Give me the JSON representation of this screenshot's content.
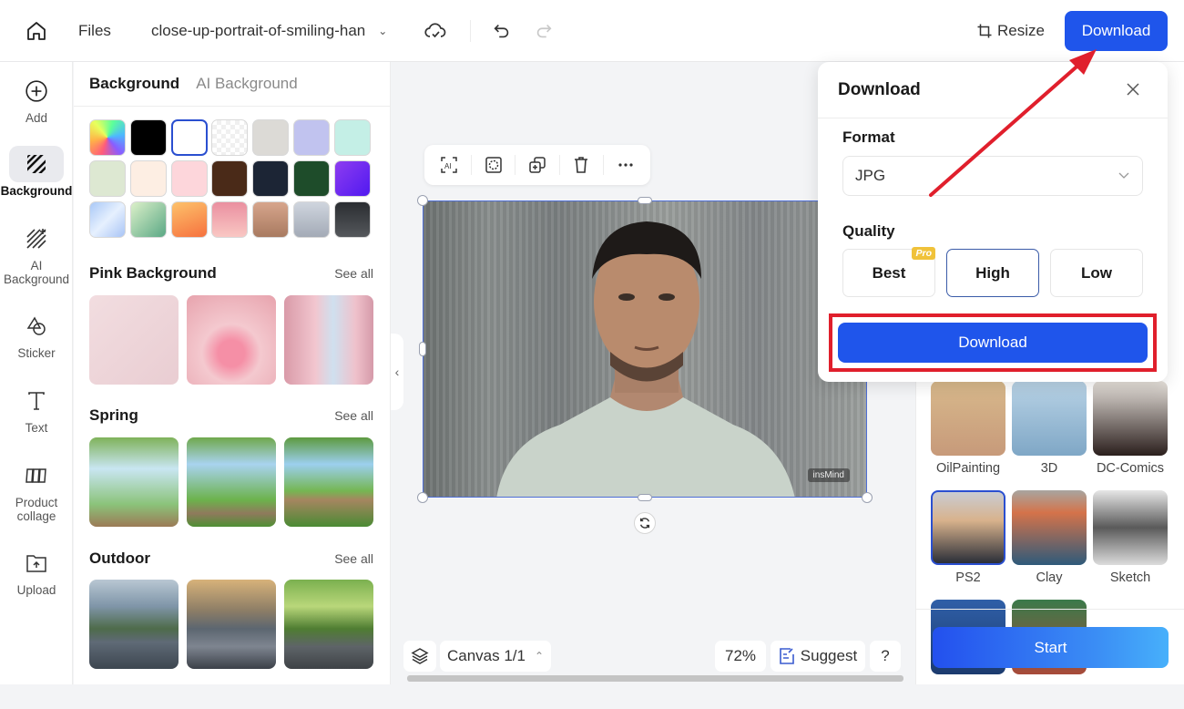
{
  "topbar": {
    "files_label": "Files",
    "filename": "close-up-portrait-of-smiling-han",
    "resize_label": "Resize",
    "download_label": "Download",
    "icons": [
      "home-icon",
      "chevron-down-icon",
      "cloud-sync-icon",
      "undo-icon",
      "redo-icon",
      "crop-icon"
    ]
  },
  "leftrail": {
    "items": [
      {
        "label": "Add",
        "icon": "plus-circle-icon",
        "active": false
      },
      {
        "label": "Background",
        "icon": "background-icon",
        "active": true
      },
      {
        "label": "AI Background",
        "icon": "ai-background-icon",
        "active": false
      },
      {
        "label": "Sticker",
        "icon": "sticker-icon",
        "active": false
      },
      {
        "label": "Text",
        "icon": "text-icon",
        "active": false
      },
      {
        "label": "Product collage",
        "icon": "collage-icon",
        "active": false
      },
      {
        "label": "Upload",
        "icon": "upload-icon",
        "active": false
      }
    ]
  },
  "bgpanel": {
    "tabs": [
      {
        "label": "Background",
        "active": true
      },
      {
        "label": "AI Background",
        "active": false
      }
    ],
    "swatches": [
      {
        "name": "rainbow",
        "fill": "conic-gradient(from 200deg, #ff5c7a, #ffb347, #e8ff5c, #5cff9a, #4db8ff, #8a5cff, #ff5c7a)"
      },
      {
        "name": "black",
        "fill": "#000000"
      },
      {
        "name": "white",
        "fill": "#ffffff",
        "selected": true
      },
      {
        "name": "transparent",
        "fill": "repeating-conic-gradient(#f0f0f0 0 25%, #ffffff 0 50%) 0 0/10px 10px"
      },
      {
        "name": "stone",
        "fill": "#dcdad6"
      },
      {
        "name": "lavender",
        "fill": "#c1c3ef"
      },
      {
        "name": "mint",
        "fill": "#c4efe6"
      },
      {
        "name": "sage",
        "fill": "#dde8d2"
      },
      {
        "name": "cream",
        "fill": "#fdeee3"
      },
      {
        "name": "blush",
        "fill": "#fdd6db"
      },
      {
        "name": "brown",
        "fill": "#4a2a18"
      },
      {
        "name": "navy",
        "fill": "#1c2535"
      },
      {
        "name": "forest",
        "fill": "#1e4c2a"
      },
      {
        "name": "violet",
        "fill": "linear-gradient(135deg, #8e3df0, #5019f0)"
      },
      {
        "name": "sky-gradient",
        "fill": "linear-gradient(135deg, #a9c8f7, #e6f0fe, #a8c4f6)"
      },
      {
        "name": "green-gradient",
        "fill": "linear-gradient(135deg, #dcf0c9, #5aa885)"
      },
      {
        "name": "orange-gradient",
        "fill": "linear-gradient(160deg, #fdc26b, #f6713e)"
      },
      {
        "name": "pink-gradient",
        "fill": "linear-gradient(180deg, #ea8fa0, #f9c7c3)"
      },
      {
        "name": "tan-gradient",
        "fill": "linear-gradient(180deg, #d7a58c, #a87a60)"
      },
      {
        "name": "silver-gradient",
        "fill": "linear-gradient(180deg, #cfd5de, #a3aab6)"
      },
      {
        "name": "charcoal-gradient",
        "fill": "linear-gradient(180deg, #2a2d31, #55585c)"
      }
    ],
    "sections": [
      {
        "title": "Pink Background",
        "see_all": "See all",
        "thumbs": [
          "linear-gradient(135deg, #f2dde0, #e9cdd2)",
          "radial-gradient(circle at 50% 65%, #f58fa6 0 18%, #f4c9cf 40%, #e7a3ad 100%)",
          "linear-gradient(90deg, #d99aa8 0%, #f2c6cf 35%, #cfe0ef 55%, #efc1cb 80%, #d59aa9 100%)"
        ]
      },
      {
        "title": "Spring",
        "see_all": "See all",
        "thumbs": [
          "linear-gradient(180deg, #7fb25a 0%, #c9e6f2 35%, #8bc37a 75%, #9b7a56 100%)",
          "linear-gradient(180deg, #6fa84c 0%, #a9d3ef 30%, #6cb24c 70%, #8f7a5c 85%, #4f8f34 100%)",
          "linear-gradient(180deg, #5d9a3f 0%, #9ccfee 30%, #75b652 60%, #a58660 70%, #4a8a34 100%)"
        ]
      },
      {
        "title": "Outdoor",
        "see_all": "See all",
        "thumbs": [
          "linear-gradient(180deg, #b9c7d3 0%, #7f95a8 30%, #4e6b4a 55%, #5f6a76 70%, #3d4650 100%)",
          "linear-gradient(180deg, #d7b27a 0%, #8c7d66 35%, #5c6670 55%, #7e8590 75%, #3b4048 100%)",
          "linear-gradient(180deg, #7bb04f 0%, #b9d77a 30%, #4f7d32 55%, #5e6468 75%, #3e4246 100%)"
        ]
      }
    ]
  },
  "canvas": {
    "toolbar_icons": [
      "ai-select-icon",
      "remove-bg-icon",
      "duplicate-icon",
      "trash-icon",
      "more-icon"
    ],
    "watermark": "insMind",
    "bottom": {
      "canvas_label": "Canvas 1/1",
      "zoom": "72%",
      "suggest_label": "Suggest",
      "help_label": "?"
    }
  },
  "rightpanel": {
    "styles": [
      {
        "label": "OilPainting",
        "fill": "linear-gradient(180deg, #d8b98c, #c79a7a)"
      },
      {
        "label": "3D",
        "fill": "linear-gradient(180deg, #b9d3e6, #7fa7c6)"
      },
      {
        "label": "DC-Comics",
        "fill": "linear-gradient(180deg, #e7e2dc, #2b1f1d)"
      },
      {
        "label": "PS2",
        "fill": "linear-gradient(180deg, #c9ccd2 0%, #d8b28c 40%, #2a2e38 100%)",
        "selected": true
      },
      {
        "label": "Clay",
        "fill": "linear-gradient(180deg, #a8a5a0 0%, #d4734a 30%, #2e5a7a 100%)"
      },
      {
        "label": "Sketch",
        "fill": "linear-gradient(180deg, #e6e6e6 0%, #5a5a5a 50%, #dcdcdc 100%)"
      },
      {
        "label": "",
        "fill": "linear-gradient(180deg, #2f5fa8, #1c3b6e)"
      },
      {
        "label": "",
        "fill": "linear-gradient(180deg, #3a7a4a, #a84a3a)"
      }
    ],
    "start_label": "Start"
  },
  "download_popup": {
    "title": "Download",
    "format_label": "Format",
    "format_value": "JPG",
    "quality_label": "Quality",
    "quality_options": [
      {
        "label": "Best",
        "badge": "Pro",
        "selected": false
      },
      {
        "label": "High",
        "selected": true
      },
      {
        "label": "Low",
        "selected": false
      }
    ],
    "download_label": "Download"
  },
  "annotations": {
    "highlight_color": "#e01f2c",
    "accent_color": "#1f55eb"
  }
}
